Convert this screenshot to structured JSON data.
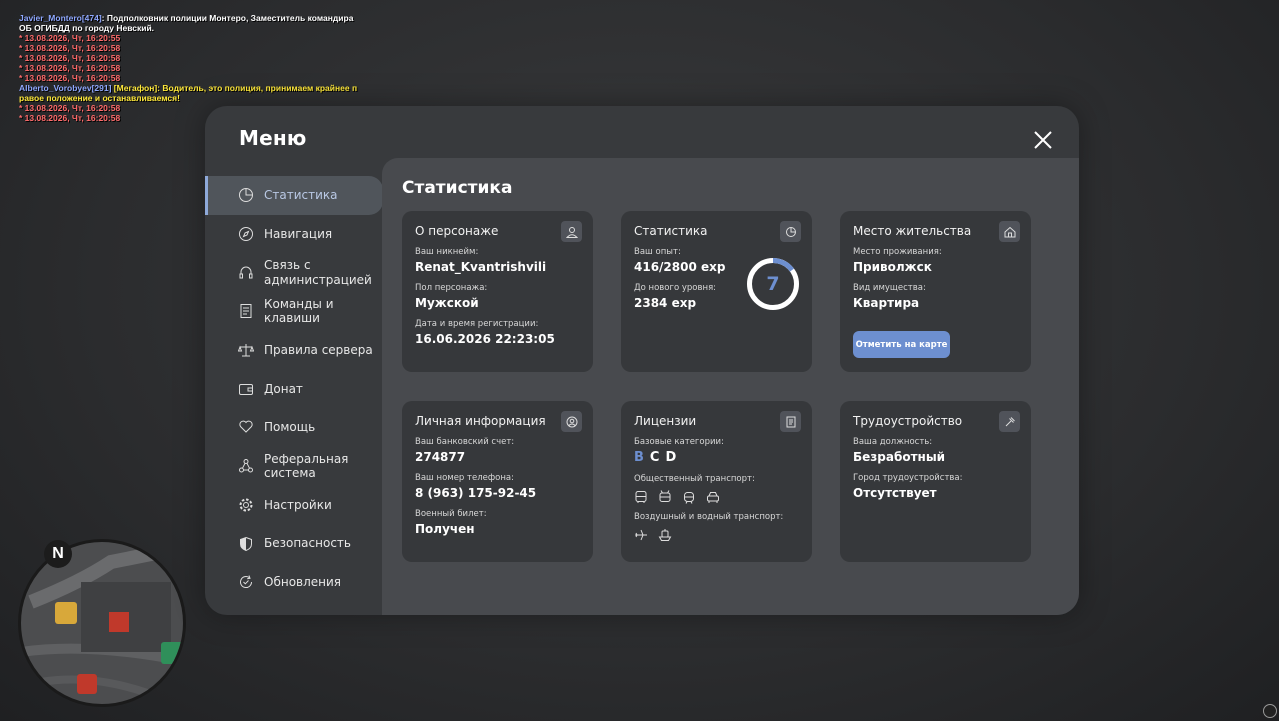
{
  "chat": [
    {
      "parts": [
        {
          "t": "Javier_Montero[474]",
          "c": "c-name"
        },
        {
          "t": ": Подполковник полиции Монтеро, Заместитель командира",
          "c": "c-white"
        }
      ]
    },
    {
      "parts": [
        {
          "t": " ОБ ОГИБДД по городу Невский.",
          "c": "c-white"
        }
      ]
    },
    {
      "parts": [
        {
          "t": " * 13.08.2026, Чт, 16:20:55",
          "c": "c-red"
        }
      ]
    },
    {
      "parts": [
        {
          "t": " * 13.08.2026, Чт, 16:20:58",
          "c": "c-red"
        }
      ]
    },
    {
      "parts": [
        {
          "t": " * 13.08.2026, Чт, 16:20:58",
          "c": "c-red"
        }
      ]
    },
    {
      "parts": [
        {
          "t": " * 13.08.2026, Чт, 16:20:58",
          "c": "c-red"
        }
      ]
    },
    {
      "parts": [
        {
          "t": " * 13.08.2026, Чт, 16:20:58",
          "c": "c-red"
        }
      ]
    },
    {
      "parts": [
        {
          "t": "Alberto_Vorobyev[291]",
          "c": "c-name"
        },
        {
          "t": " [Мегафон]: Водитель, это полиция, принимаем крайнее п",
          "c": "c-yellow"
        }
      ]
    },
    {
      "parts": [
        {
          "t": "равое положение и останавливаемся!",
          "c": "c-yellow"
        }
      ]
    },
    {
      "parts": [
        {
          "t": " * 13.08.2026, Чт, 16:20:58",
          "c": "c-red"
        }
      ]
    },
    {
      "parts": [
        {
          "t": " * 13.08.2026, Чт, 16:20:58",
          "c": "c-red"
        }
      ]
    }
  ],
  "menu": {
    "title": "Меню",
    "sidebar": [
      {
        "label": "Статистика",
        "icon": "pie-chart-icon",
        "active": true
      },
      {
        "label": "Навигация",
        "icon": "compass-icon"
      },
      {
        "label": "Связь с\nадминистрацией",
        "icon": "headset-icon"
      },
      {
        "label": "Команды и\nклавиши",
        "icon": "document-icon"
      },
      {
        "label": "Правила сервера",
        "icon": "scales-icon"
      },
      {
        "label": "Донат",
        "icon": "wallet-icon"
      },
      {
        "label": "Помощь",
        "icon": "heart-hand-icon"
      },
      {
        "label": "Реферальная\nсистема",
        "icon": "share-nodes-icon"
      },
      {
        "label": "Настройки",
        "icon": "gear-icon"
      },
      {
        "label": "Безопасность",
        "icon": "shield-icon"
      },
      {
        "label": "Обновления",
        "icon": "refresh-check-icon"
      }
    ]
  },
  "content": {
    "title": "Статистика",
    "character": {
      "title": "О персонаже",
      "icon": "person-icon",
      "nickname_label": "Ваш никнейм:",
      "nickname": "Renat_Kvantrishvili",
      "gender_label": "Пол персонажа:",
      "gender": "Мужской",
      "reg_label": "Дата и время регистрации:",
      "reg": "16.06.2026 22:23:05"
    },
    "stats": {
      "title": "Статистика",
      "icon": "pie-chart-icon",
      "exp_label": "Ваш опыт:",
      "exp": "416/2800 exp",
      "next_label": "До нового уровня:",
      "next": "2384 exp",
      "level": "7",
      "progress": 0.149
    },
    "residence": {
      "title": "Место жительства",
      "icon": "house-icon",
      "place_label": "Место проживания:",
      "place": "Приволжск",
      "type_label": "Вид имущества:",
      "type": "Квартира",
      "button": "Отметить на карте"
    },
    "personal": {
      "title": "Личная информация",
      "icon": "user-circle-icon",
      "bank_label": "Ваш банковский счет:",
      "bank": "274877",
      "phone_label": "Ваш номер телефона:",
      "phone": "8 (963) 175-92-45",
      "military_label": "Военный билет:",
      "military": "Получен"
    },
    "licenses": {
      "title": "Лицензии",
      "icon": "id-card-icon",
      "base_label": "Базовые категории:",
      "categories": [
        {
          "t": "B",
          "color": "#6d8fd0"
        },
        {
          "t": "C",
          "color": "#ffffff"
        },
        {
          "t": "D",
          "color": "#ffffff"
        }
      ],
      "public_label": "Общественный транспорт:",
      "public_icons": [
        "bus-icon",
        "trolleybus-icon",
        "tram-icon",
        "taxi-icon"
      ],
      "air_label": "Воздушный и водный транспорт:",
      "air_icons": [
        "airplane-icon",
        "boat-icon"
      ]
    },
    "job": {
      "title": "Трудоустройство",
      "icon": "hammer-icon",
      "position_label": "Ваша должность:",
      "position": "Безработный",
      "city_label": "Город трудоустройства:",
      "city": "Отсутствует"
    }
  },
  "minimap": {
    "north": "N"
  }
}
